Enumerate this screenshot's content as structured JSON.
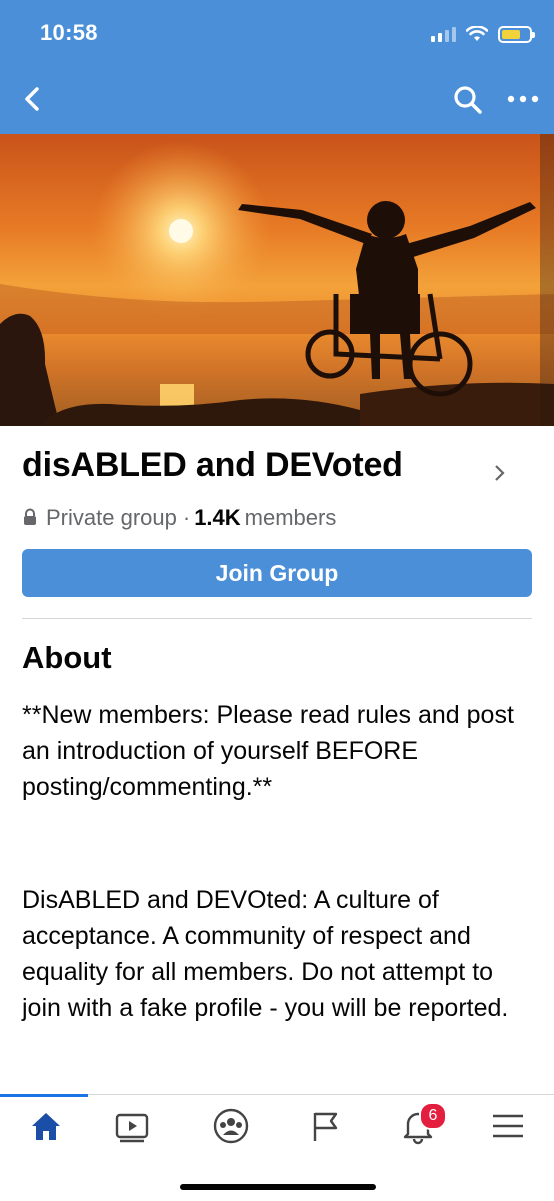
{
  "status_bar": {
    "time": "10:58"
  },
  "group": {
    "name": "disABLED and DEVoted",
    "privacy": "Private group",
    "separator": "·",
    "member_count": "1.4K",
    "members_label": "members",
    "join_label": "Join Group"
  },
  "about": {
    "heading": "About",
    "paragraph1": "**New members: Please read rules and post an introduction of yourself BEFORE posting/commenting.**",
    "paragraph2": "DisABLED and DEVOted: A culture of acceptance.  A community of respect and equality for all members. Do not attempt to join with a fake profile - you will be reported."
  },
  "tabbar": {
    "notifications_badge": "6"
  },
  "colors": {
    "header_blue": "#4a8fd8",
    "active_tab": "#1b74e4",
    "badge_red": "#e41e3f"
  },
  "icons": [
    "back-chevron-icon",
    "search-icon",
    "more-icon",
    "home-icon",
    "video-icon",
    "groups-icon",
    "pages-flag-icon",
    "bell-icon",
    "menu-icon",
    "lock-icon"
  ]
}
